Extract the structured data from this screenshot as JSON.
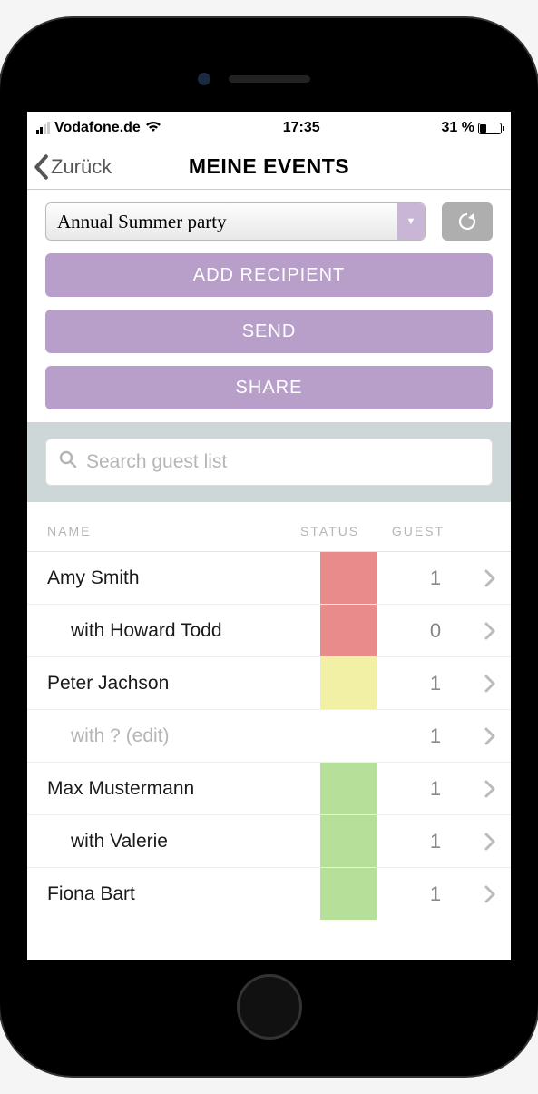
{
  "status_bar": {
    "carrier": "Vodafone.de",
    "time": "17:35",
    "battery_pct": "31 %"
  },
  "nav": {
    "back_label": "Zurück",
    "title": "MEINE EVENTS"
  },
  "event_select": {
    "value": "Annual Summer party"
  },
  "buttons": {
    "add_recipient": "ADD RECIPIENT",
    "send": "SEND",
    "share": "SHARE"
  },
  "search": {
    "placeholder": "Search guest list"
  },
  "headers": {
    "name": "NAME",
    "status": "STATUS",
    "guest": "GUEST"
  },
  "rows": [
    {
      "name": "Amy Smith",
      "sub": false,
      "placeholder": false,
      "status": "red",
      "count": "1"
    },
    {
      "name": "with Howard Todd",
      "sub": true,
      "placeholder": false,
      "status": "red",
      "count": "0"
    },
    {
      "name": "Peter Jachson",
      "sub": false,
      "placeholder": false,
      "status": "yellow",
      "count": "1"
    },
    {
      "name": "with ? (edit)",
      "sub": true,
      "placeholder": true,
      "status": "none",
      "count": "1"
    },
    {
      "name": "Max Mustermann",
      "sub": false,
      "placeholder": false,
      "status": "green",
      "count": "1"
    },
    {
      "name": "with Valerie",
      "sub": true,
      "placeholder": false,
      "status": "green",
      "count": "1"
    },
    {
      "name": "Fiona Bart",
      "sub": false,
      "placeholder": false,
      "status": "green",
      "count": "1"
    }
  ]
}
